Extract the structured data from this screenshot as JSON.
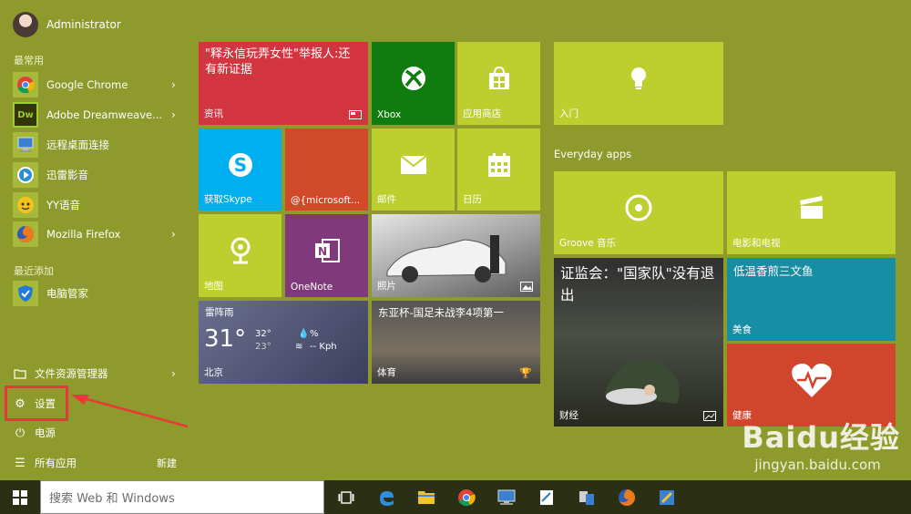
{
  "user": {
    "name": "Administrator"
  },
  "sections": {
    "most_used": "最常用",
    "recently_added": "最近添加"
  },
  "most_used": [
    {
      "label": "Google Chrome",
      "icon": "chrome-icon"
    },
    {
      "label": "Adobe Dreamweave...",
      "icon": "dreamweaver-icon",
      "icon_text": "Dw"
    },
    {
      "label": "远程桌面连接",
      "icon": "remote-desktop-icon"
    },
    {
      "label": "迅雷影音",
      "icon": "xunlei-player-icon"
    },
    {
      "label": "YY语音",
      "icon": "yy-voice-icon"
    },
    {
      "label": "Mozilla Firefox",
      "icon": "firefox-icon"
    }
  ],
  "recent": [
    {
      "label": "电脑管家",
      "icon": "pc-manager-icon"
    }
  ],
  "system": {
    "file_explorer": "文件资源管理器",
    "settings": "设置",
    "power": "电源",
    "all_apps": "所有应用",
    "new": "新建"
  },
  "tiles": {
    "news": {
      "headline": "\"释永信玩弄女性\"举报人:还有新证据",
      "label": "资讯"
    },
    "xbox": "Xbox",
    "store": "应用商店",
    "intro": "入门",
    "skype": "获取Skype",
    "outlook": "@{microsoft...",
    "mail": "邮件",
    "calendar": "日历",
    "maps": "地图",
    "onenote": "OneNote",
    "photos": "照片",
    "weather": {
      "condition": "雷阵雨",
      "temp": "31°",
      "high": "32°",
      "low": "23°",
      "humidity": "%",
      "wind": "-- Kph",
      "city": "北京"
    },
    "sports": {
      "headline": "东亚杯-国足未战李4项第一",
      "label": "体育"
    },
    "finance": {
      "headline": "证监会：\"国家队\"没有退出",
      "label": "财经"
    },
    "groove": "Groove 音乐",
    "movies": "电影和电视",
    "food": {
      "headline": "低温香煎三文鱼",
      "label": "美食"
    },
    "health": "健康"
  },
  "groups": {
    "everyday": "Everyday apps"
  },
  "taskbar": {
    "search_placeholder": "搜索 Web 和 Windows"
  },
  "watermark": {
    "brand": "Baidu经验",
    "url": "jingyan.baidu.com"
  },
  "colors": {
    "accent": "#bccf2e",
    "start_bg": "#8f9a2c",
    "red": "#d23440",
    "skype": "#00aff0",
    "onenote": "#80397b",
    "xbox": "#107c10",
    "orange": "#d04a2a",
    "teal": "#188ea4",
    "health": "#d2452d"
  }
}
